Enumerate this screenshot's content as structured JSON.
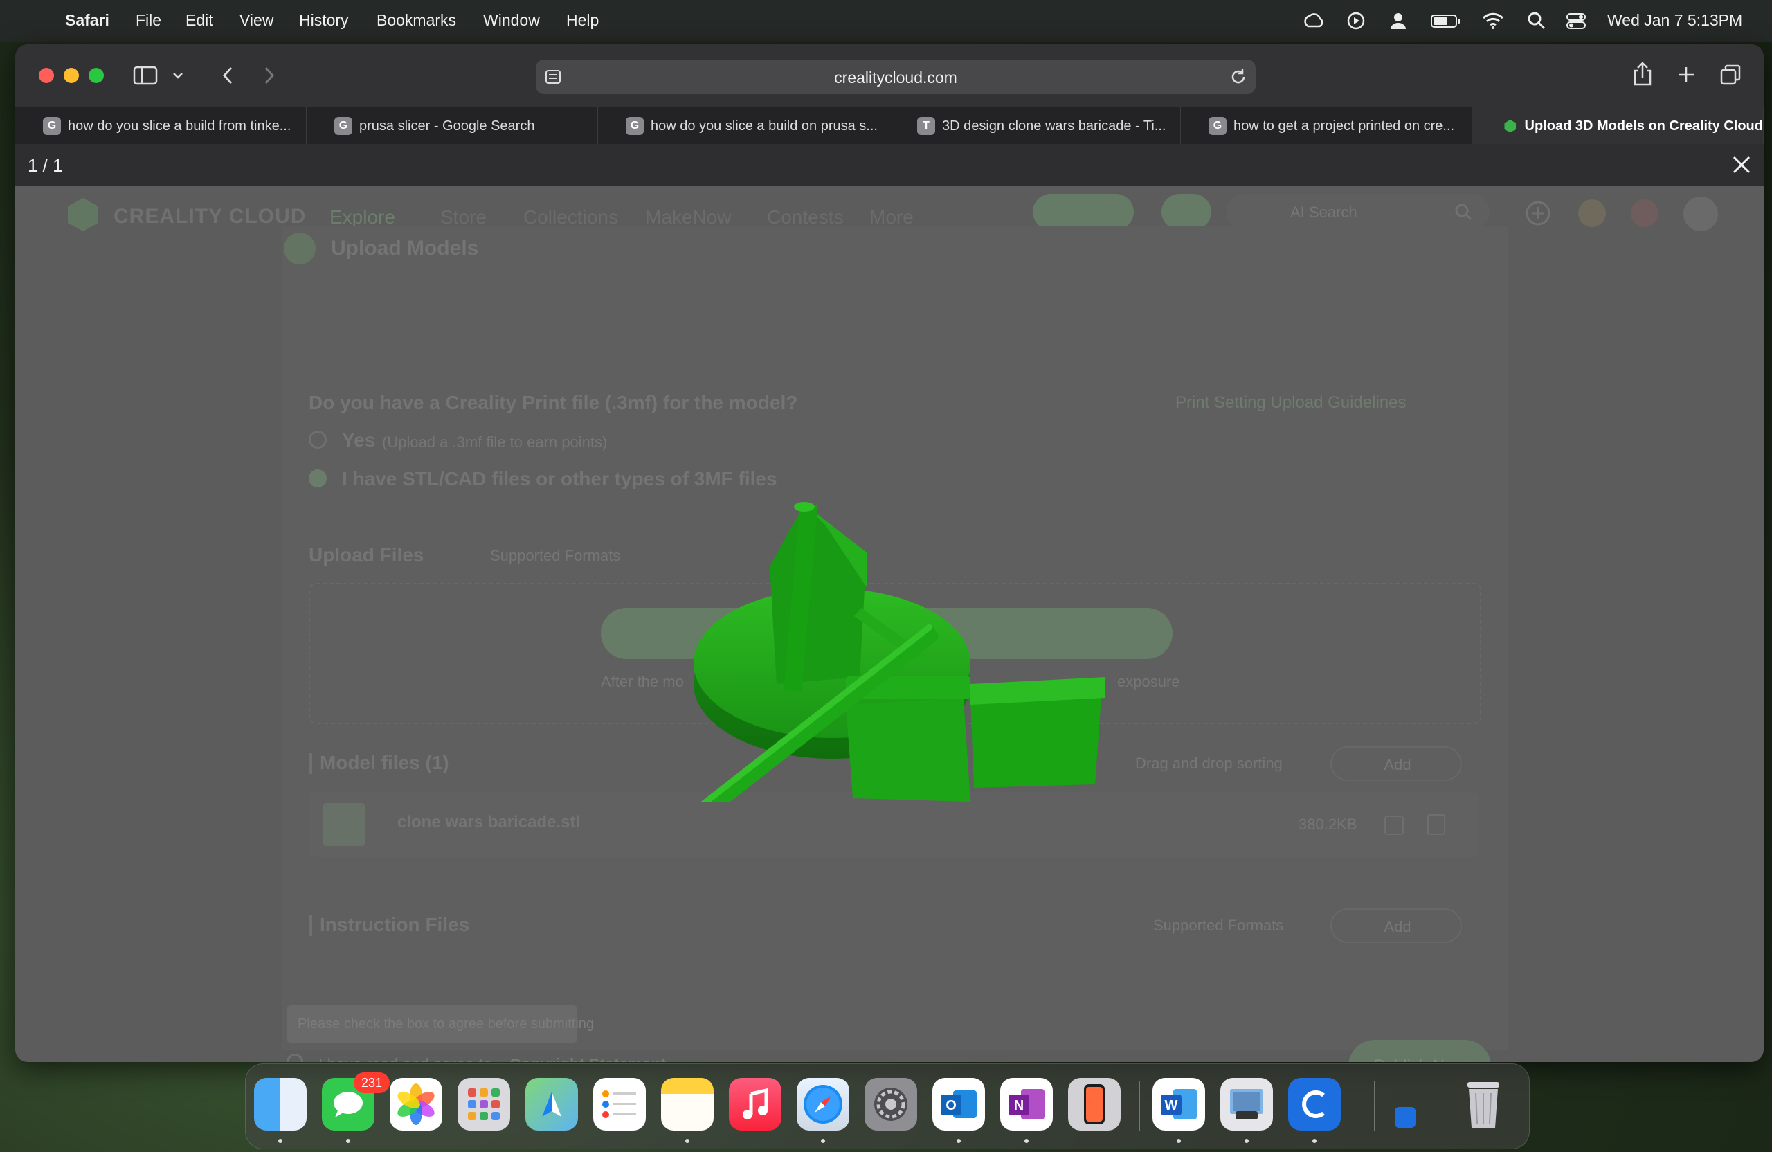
{
  "menubar": {
    "app": "Safari",
    "items": [
      "File",
      "Edit",
      "View",
      "History",
      "Bookmarks",
      "Window",
      "Help"
    ],
    "datetime": "Wed Jan 7  5:13PM"
  },
  "browser": {
    "url": "crealitycloud.com",
    "tabs": [
      {
        "label": "how do you slice a build from tinke...",
        "favicon": "G"
      },
      {
        "label": "prusa slicer - Google Search",
        "favicon": "G"
      },
      {
        "label": "how do you slice a build on prusa s...",
        "favicon": "G"
      },
      {
        "label": "3D design clone wars baricade - Ti...",
        "favicon": "T"
      },
      {
        "label": "how to get a project printed on cre...",
        "favicon": "G"
      },
      {
        "label": "Upload 3D Models on Creality Cloud",
        "favicon": "creality"
      }
    ]
  },
  "viewer": {
    "counter": "1 / 1"
  },
  "site": {
    "logo": "CREALITY CLOUD",
    "nav": [
      "Explore",
      "Store",
      "Collections",
      "MakeNow",
      "Contests",
      "More"
    ],
    "search_placeholder": "AI Search"
  },
  "form": {
    "heading": "Upload Models",
    "question": "Do you have a Creality Print file (.3mf) for the model?",
    "guideline_link": "Print Setting Upload Guidelines",
    "option_yes": "Yes",
    "option_yes_note": "(Upload a .3mf file to earn points)",
    "option_no": "I have STL/CAD files or other types of 3MF files",
    "upload_files": "Upload Files",
    "supported_formats": "Supported Formats",
    "upload_button": "Upload Files",
    "upload_hint_left": "After the mo",
    "upload_hint_right": "exposure",
    "model_files": "Model files (1)",
    "drag_sort": "Drag and drop sorting",
    "add": "Add",
    "file_name": "clone wars baricade.stl",
    "file_size": "380.2KB",
    "instruction_files": "Instruction Files",
    "instruction_formats": "Supported Formats",
    "tooltip": "Please check the box to agree before submitting",
    "agree_text": "I have read and agree to",
    "agree_link": "Copyright Statement.",
    "publish": "Publish Now"
  },
  "dock": {
    "messages_badge": "231",
    "apps": [
      "finder-icon",
      "messages-icon",
      "photos-icon",
      "launchpad-icon",
      "maps-icon",
      "reminders-icon",
      "notes-icon",
      "music-icon",
      "safari-icon",
      "system-settings-icon",
      "outlook-icon",
      "onenote-icon",
      "iphone-mirroring-icon",
      "word-icon",
      "preview-icon",
      "creality-print-icon",
      "trash-icon"
    ]
  },
  "colors": {
    "model_green": "#1f9e1a",
    "close_red": "#ff5f57",
    "minimize_yellow": "#febc2e",
    "zoom_green": "#28c840"
  }
}
